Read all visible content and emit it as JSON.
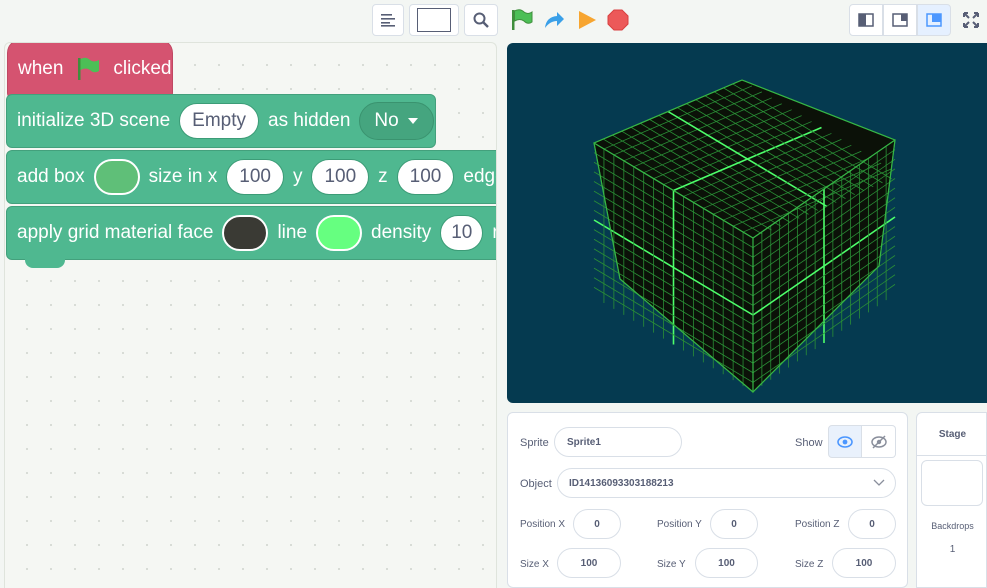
{
  "toolbar": {
    "zoom_value": "",
    "icons": [
      "list-icon",
      "search-icon",
      "green-flag-icon",
      "turbo-icon",
      "play-icon",
      "stop-icon",
      "small-stage-icon",
      "normal-stage-icon",
      "large-stage-icon",
      "fullscreen-icon"
    ]
  },
  "blocks": {
    "hat": {
      "when": "when",
      "clicked": "clicked"
    },
    "init": {
      "label": "initialize 3D scene",
      "scene": "Empty",
      "hidden_label": "as hidden",
      "hidden_value": "No"
    },
    "box": {
      "label": "add box",
      "size_label": "size in x",
      "x": "100",
      "y_label": "y",
      "y": "100",
      "z_label": "z",
      "z": "100",
      "edge_label": "edge"
    },
    "grid": {
      "label": "apply grid material face",
      "line_label": "line",
      "density_label": "density",
      "density": "10",
      "trail": "r"
    },
    "colors": {
      "box": "#5fbf78",
      "face": "#3a3a34",
      "line": "#66ff80"
    }
  },
  "sprite_panel": {
    "sprite_label": "Sprite",
    "sprite_name": "Sprite1",
    "show_label": "Show",
    "object_label": "Object",
    "object_value": "ID14136093303188213",
    "pos_x_label": "Position X",
    "pos_x": "0",
    "pos_y_label": "Position Y",
    "pos_y": "0",
    "pos_z_label": "Position Z",
    "pos_z": "0",
    "size_x_label": "Size X",
    "size_x": "100",
    "size_y_label": "Size Y",
    "size_y": "100",
    "size_z_label": "Size Z",
    "size_z": "100"
  },
  "stage_panel": {
    "title": "Stage",
    "backdrops_label": "Backdrops",
    "backdrops_count": "1"
  },
  "colors": {
    "event": "#d55370",
    "extension": "#4fb890",
    "stage_bg": "#053a50",
    "grid_line": "#3cdc5a"
  }
}
